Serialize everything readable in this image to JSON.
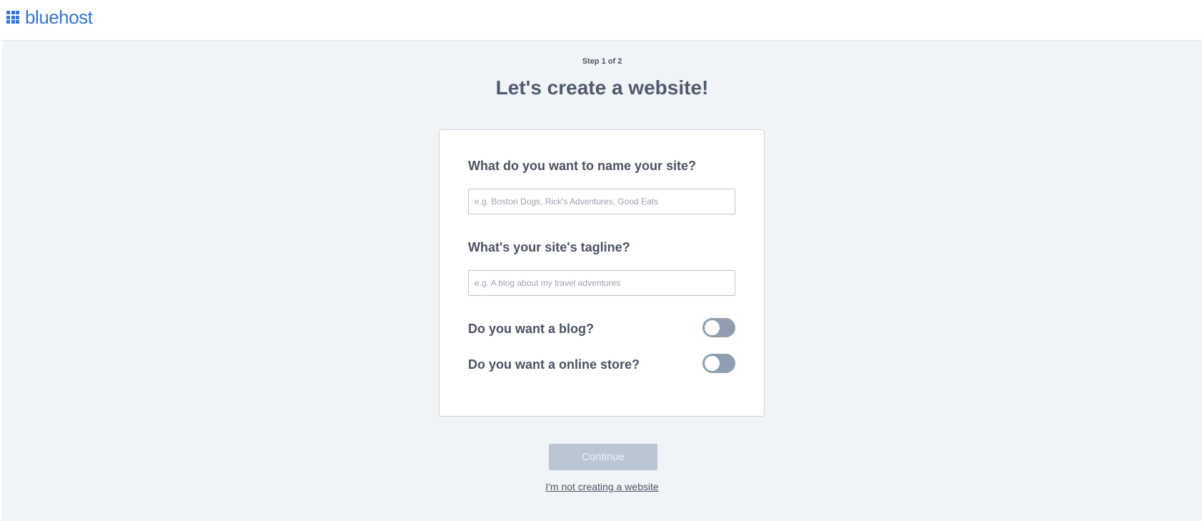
{
  "brand": {
    "name": "bluehost",
    "icon": "grid-icon",
    "color": "#3575d3"
  },
  "wizard": {
    "step": "Step 1 of 2",
    "title": "Let's create a website!"
  },
  "form": {
    "site_name": {
      "label": "What do you want to name your site?",
      "placeholder": "e.g. Boston Dogs, Rick's Adventures, Good Eats",
      "value": ""
    },
    "tagline": {
      "label": "What's your site's tagline?",
      "placeholder": "e.g. A blog about my travel adventures",
      "value": ""
    },
    "blog_toggle": {
      "label": "Do you want a blog?",
      "on": false
    },
    "store_toggle": {
      "label": "Do you want a online store?",
      "on": false
    }
  },
  "actions": {
    "continue_label": "Continue",
    "continue_enabled": false,
    "skip_label": "I'm not creating a website"
  },
  "colors": {
    "background": "#f0f4f7",
    "toggle_off": "#8f9fb1",
    "button_disabled": "#bac6d3"
  }
}
